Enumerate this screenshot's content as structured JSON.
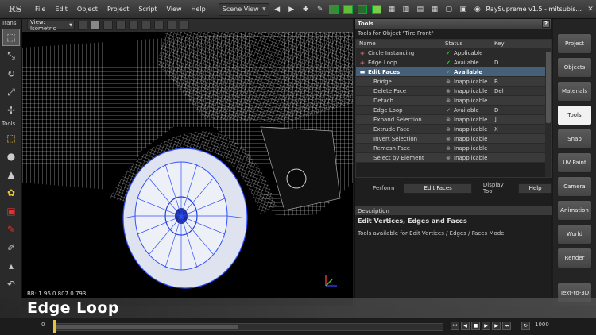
{
  "app": {
    "title": "RaySupreme v1.5 - mitsubis...",
    "logo": "RS",
    "menu": [
      "File",
      "Edit",
      "Object",
      "Project",
      "Script",
      "View",
      "Help"
    ],
    "scene_view": "Scene View"
  },
  "left_toolbar": {
    "header": "Trans",
    "section_label": "Tools"
  },
  "viewport": {
    "view_mode": "View: Isometric",
    "bbox_text": "BB: 1.96 0.807 0.793"
  },
  "tools_panel": {
    "title": "Tools",
    "subtitle": "Tools for Object \"Tire Front\"",
    "columns": [
      "Name",
      "Status",
      "Key"
    ],
    "rows": [
      {
        "name": "Circle Instancing",
        "status": "Applicable",
        "key": "",
        "kind": "top",
        "status_icon": "check"
      },
      {
        "name": "Edge Loop",
        "status": "Available",
        "key": "D",
        "kind": "top",
        "status_icon": "check"
      },
      {
        "name": "Edit Faces",
        "status": "Available",
        "key": "",
        "kind": "group",
        "status_icon": "check"
      },
      {
        "name": "Bridge",
        "status": "Inapplicable",
        "key": "B",
        "kind": "sub",
        "status_icon": "cross"
      },
      {
        "name": "Delete Face",
        "status": "Inapplicable",
        "key": "Del",
        "kind": "sub",
        "status_icon": "cross"
      },
      {
        "name": "Detach",
        "status": "Inapplicable",
        "key": "",
        "kind": "sub",
        "status_icon": "cross"
      },
      {
        "name": "Edge Loop",
        "status": "Available",
        "key": "D",
        "kind": "sub",
        "status_icon": "check"
      },
      {
        "name": "Expand Selection",
        "status": "Inapplicable",
        "key": "]",
        "kind": "sub",
        "status_icon": "cross"
      },
      {
        "name": "Extrude Face",
        "status": "Inapplicable",
        "key": "X",
        "kind": "sub",
        "status_icon": "cross"
      },
      {
        "name": "Invert Selection",
        "status": "Inapplicable",
        "key": "",
        "kind": "sub",
        "status_icon": "cross"
      },
      {
        "name": "Remesh Face",
        "status": "Inapplicable",
        "key": "",
        "kind": "sub",
        "status_icon": "cross"
      },
      {
        "name": "Select by Element",
        "status": "Inapplicable",
        "key": "",
        "kind": "sub",
        "status_icon": "cross"
      }
    ],
    "perform_label": "Perform",
    "perform_button": "Edit Faces",
    "display_tool_label": "Display Tool",
    "help_button": "Help",
    "description_header": "Description",
    "description_title": "Edit Vertices, Edges and Faces",
    "description_text": "Tools available for Edit Vertices / Edges / Faces Mode."
  },
  "right_tabs": {
    "items": [
      "Project",
      "Objects",
      "Materials",
      "Tools",
      "Snap",
      "UV Paint",
      "Camera",
      "Animation",
      "World",
      "Render",
      "Text-to-3D"
    ],
    "active": "Tools"
  },
  "overlay": {
    "caption": "Edge Loop"
  },
  "timeline": {
    "start_frame": "0",
    "end_frame": "1000"
  },
  "colors": {
    "accent_group_row": "#46607a",
    "status_ok": "#33cc33",
    "wire": "#ffffff",
    "selected_mesh": "#3050ff"
  }
}
